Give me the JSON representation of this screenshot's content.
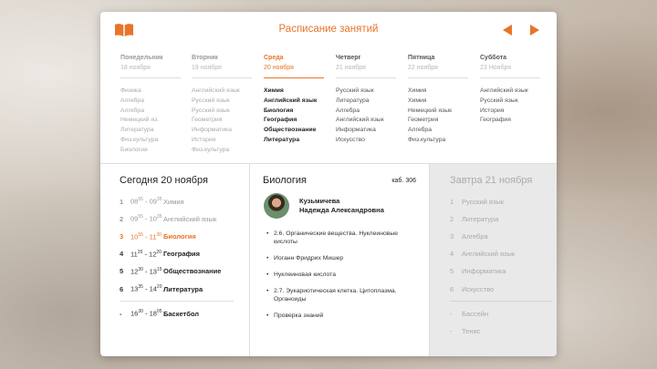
{
  "header": {
    "title": "Расписание занятий",
    "book_icon": "book-icon",
    "prev_icon": "triangle-left-icon",
    "next_icon": "triangle-right-icon",
    "accent_color": "#e8742a"
  },
  "week": [
    {
      "name": "Понедельник",
      "date": "18 ноября",
      "state": "past",
      "subjects": [
        "Физика",
        "Алгебра",
        "Алгебра",
        "Немецкий яз.",
        "Литература",
        "Физ.культура",
        "Биология"
      ]
    },
    {
      "name": "Вторник",
      "date": "19 ноября",
      "state": "past",
      "subjects": [
        "Английский язык",
        "Русский язык",
        "Русский язык",
        "Геометрия",
        "Информатика",
        "История",
        "Физ.культура"
      ]
    },
    {
      "name": "Среда",
      "date": "20 ноября",
      "state": "today",
      "subjects": [
        "Химия",
        "Английский язык",
        "Биология",
        "География",
        "Обществознание",
        "Литература"
      ]
    },
    {
      "name": "Четверг",
      "date": "21 ноября",
      "state": "future",
      "subjects": [
        "Русский язык",
        "Литература",
        "Алгебра",
        "Английский язык",
        "Информатика",
        "Искусство"
      ]
    },
    {
      "name": "Пятница",
      "date": "22 ноября",
      "state": "future",
      "subjects": [
        "Химия",
        "Химия",
        "Немецкий язык",
        "Геометрия",
        "Алгебра",
        "Физ.культура"
      ]
    },
    {
      "name": "Суббота",
      "date": "23 Ноября",
      "state": "future",
      "subjects": [
        "Английский язык",
        "Русский язык",
        "История",
        "География"
      ]
    }
  ],
  "today": {
    "title": "Сегодня 20 ноября",
    "lessons": [
      {
        "num": "1",
        "start_h": "08",
        "start_m": "55",
        "end_h": "09",
        "end_m": "35",
        "subject": "Химия",
        "state": "done"
      },
      {
        "num": "2",
        "start_h": "09",
        "start_m": "55",
        "end_h": "10",
        "end_m": "35",
        "subject": "Английский язык",
        "state": "done"
      },
      {
        "num": "3",
        "start_h": "10",
        "start_m": "55",
        "end_h": "11",
        "end_m": "30",
        "subject": "Биология",
        "state": "current"
      },
      {
        "num": "4",
        "start_h": "11",
        "start_m": "35",
        "end_h": "12",
        "end_m": "20",
        "subject": "География",
        "state": "upcoming"
      },
      {
        "num": "5",
        "start_h": "12",
        "start_m": "30",
        "end_h": "13",
        "end_m": "15",
        "subject": "Обществознание",
        "state": "upcoming"
      },
      {
        "num": "6",
        "start_h": "13",
        "start_m": "35",
        "end_h": "14",
        "end_m": "20",
        "subject": "Литература",
        "state": "upcoming"
      }
    ],
    "extra": [
      {
        "num": "-",
        "start_h": "16",
        "start_m": "30",
        "end_h": "18",
        "end_m": "05",
        "subject": "Баскетбол",
        "state": "upcoming"
      }
    ]
  },
  "detail": {
    "subject": "Биология",
    "room": "каб. 306",
    "teacher_line1": "Кузьмичева",
    "teacher_line2": "Надежда Александровна",
    "topics": [
      "2.6. Органические вещества. Нуклеиновые кислоты",
      "Иоганн Фридрих Мишер",
      "Нуклеиновая кислота",
      "2.7. Эукариотическая клетка. Цитоплазма. Органоиды",
      "Проверка знаний"
    ]
  },
  "tomorrow": {
    "title": "Завтра 21 ноября",
    "lessons": [
      {
        "num": "1",
        "subject": "Русский язык"
      },
      {
        "num": "2",
        "subject": "Литература"
      },
      {
        "num": "3",
        "subject": "Алгебра"
      },
      {
        "num": "4",
        "subject": "Английский язык"
      },
      {
        "num": "5",
        "subject": "Информатика"
      },
      {
        "num": "6",
        "subject": "Искусство"
      }
    ],
    "extra": [
      {
        "num": "-",
        "subject": "Бассейн"
      },
      {
        "num": "-",
        "subject": "Тенис"
      }
    ]
  }
}
